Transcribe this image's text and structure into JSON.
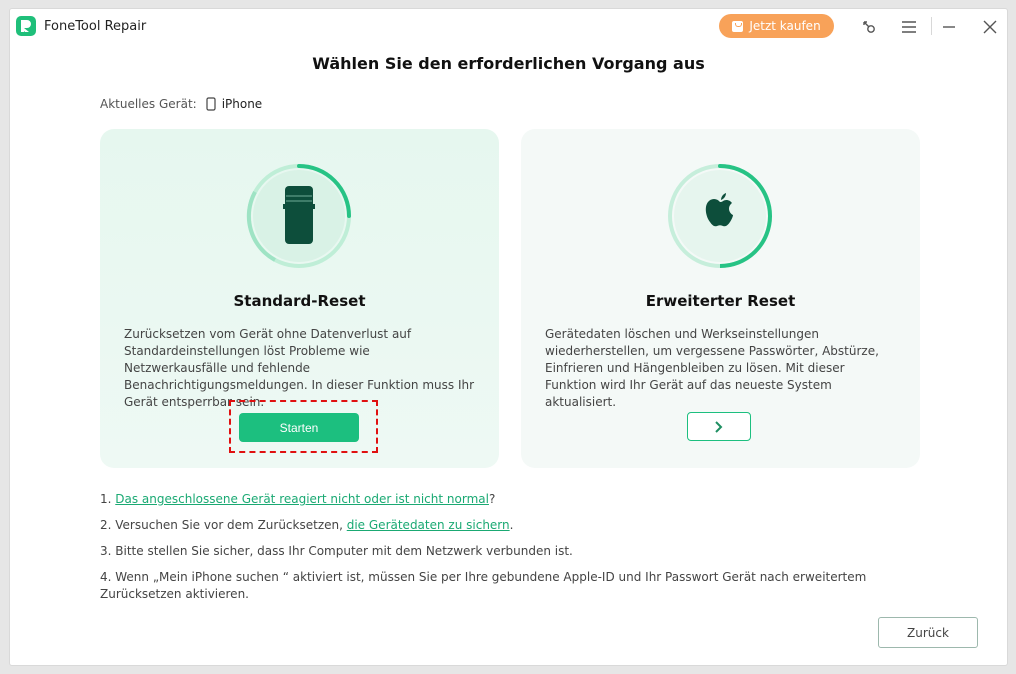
{
  "app": {
    "title": "FoneTool Repair"
  },
  "titlebar": {
    "buy_label": "Jetzt kaufen",
    "icons": [
      "key-icon",
      "menu-icon",
      "minimize-icon",
      "close-icon"
    ]
  },
  "heading": "Wählen Sie den erforderlichen Vorgang aus",
  "device": {
    "label": "Aktuelles Gerät:",
    "name": "iPhone"
  },
  "cards": [
    {
      "title": "Standard-Reset",
      "description": "Zurücksetzen vom Gerät ohne Datenverlust auf Standardeinstellungen löst Probleme wie Netzwerkausfälle und fehlende Benachrichtigungsmeldungen. In dieser Funktion muss Ihr Gerät entsperrbar sein.",
      "button_label": "Starten",
      "icon": "phone-icon"
    },
    {
      "title": "Erweiterter Reset",
      "description": "Gerätedaten löschen und Werkseinstellungen wiederherstellen, um vergessene Passwörter, Abstürze, Einfrieren und Hängenbleiben zu lösen. Mit dieser Funktion wird Ihr Gerät auf das neueste System aktualisiert.",
      "button_icon": "chevron-right-icon",
      "icon": "apple-icon"
    }
  ],
  "notes": {
    "n1_prefix": "1. ",
    "n1_link": "Das angeschlossene Gerät reagiert nicht oder ist nicht normal",
    "n1_suffix": "?",
    "n2_prefix": "2. Versuchen Sie vor dem Zurücksetzen, ",
    "n2_link": "die Gerätedaten zu sichern",
    "n2_suffix": ".",
    "n3": "3. Bitte stellen Sie sicher, dass Ihr Computer mit dem Netzwerk verbunden ist.",
    "n4": "4. Wenn „Mein iPhone suchen “ aktiviert ist, müssen Sie per Ihre gebundene Apple-ID und Ihr Passwort Gerät nach erweitertem Zurücksetzen aktivieren."
  },
  "back_label": "Zurück",
  "colors": {
    "accent": "#1cbf7f",
    "buy": "#f8a259",
    "highlight": "#e01010"
  }
}
